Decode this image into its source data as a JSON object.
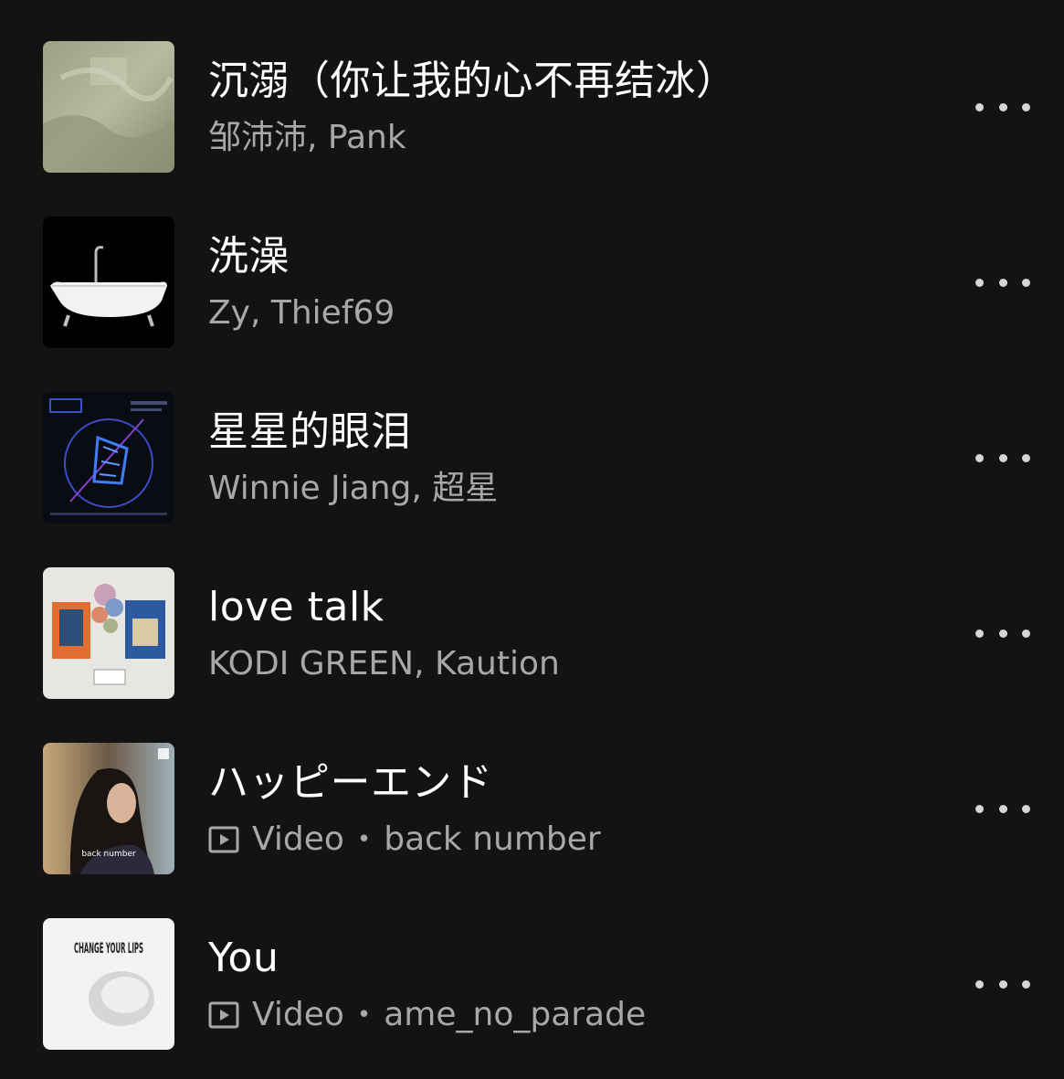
{
  "tracks": [
    {
      "title": "沉溺（你让我的心不再结冰）",
      "subtitle": "邹沛沛, Pank",
      "art": "misty-green-cover",
      "is_video": false
    },
    {
      "title": "洗澡",
      "subtitle": "Zy, Thief69",
      "art": "bathtub-cover",
      "is_video": false
    },
    {
      "title": "星星的眼泪",
      "subtitle": "Winnie Jiang, 超星",
      "art": "neon-blue-cover",
      "is_video": false
    },
    {
      "title": "love talk",
      "subtitle": "KODI GREEN, Kaution",
      "art": "flowers-collage-cover",
      "is_video": false
    },
    {
      "title": "ハッピーエンド",
      "type_label": "Video",
      "artist": "back number",
      "art": "woman-portrait-cover",
      "art_text": "back number",
      "is_video": true
    },
    {
      "title": "You",
      "type_label": "Video",
      "artist": "ame_no_parade",
      "art": "change-your-lips-cover",
      "art_text": "CHANGE YOUR LIPS",
      "is_video": true
    }
  ],
  "colors": {
    "background": "#131313",
    "title": "#ffffff",
    "subtitle": "#a8a8a8"
  }
}
